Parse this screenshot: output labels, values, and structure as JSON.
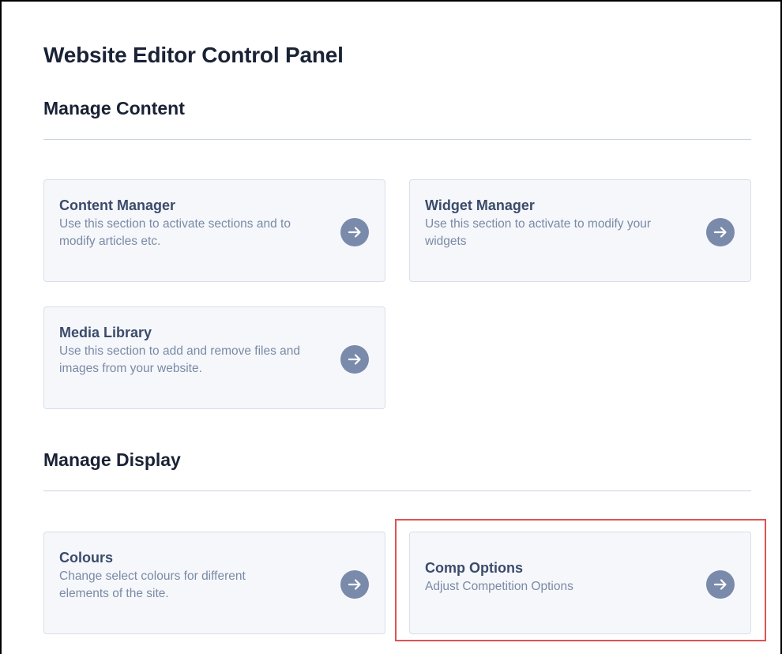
{
  "page": {
    "title": "Website Editor Control Panel"
  },
  "sections": [
    {
      "title": "Manage Content",
      "cards": [
        {
          "title": "Content Manager",
          "description": "Use this section to activate sections and to modify articles etc.",
          "icon": "arrow-right-icon"
        },
        {
          "title": "Widget Manager",
          "description": "Use this section to activate to modify your widgets",
          "icon": "arrow-right-icon"
        },
        {
          "title": "Media Library",
          "description": "Use this section to add and remove files and images from your website.",
          "icon": "arrow-right-icon"
        }
      ]
    },
    {
      "title": "Manage Display",
      "cards": [
        {
          "title": "Colours",
          "description": "Change select colours for different elements of the site.",
          "icon": "arrow-right-icon"
        },
        {
          "title": "Comp Options",
          "description": "Adjust Competition Options",
          "icon": "arrow-right-icon",
          "highlighted": true
        }
      ]
    }
  ],
  "colors": {
    "heading": "#1a2236",
    "card_title": "#3b4b6b",
    "card_desc": "#7b8aa5",
    "card_bg": "#f5f7fb",
    "card_border": "#d8dfe9",
    "arrow_bg": "#7a8aab",
    "highlight": "#e05252"
  }
}
